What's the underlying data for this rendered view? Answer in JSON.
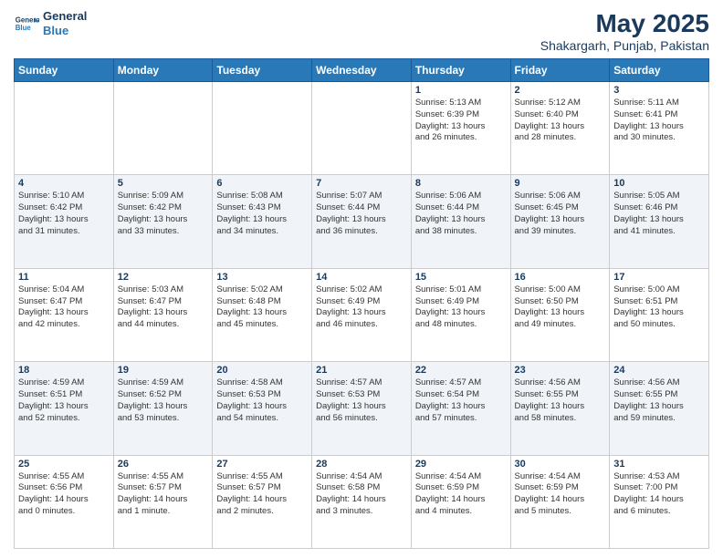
{
  "header": {
    "logo_line1": "General",
    "logo_line2": "Blue",
    "title": "May 2025",
    "subtitle": "Shakargarh, Punjab, Pakistan"
  },
  "weekdays": [
    "Sunday",
    "Monday",
    "Tuesday",
    "Wednesday",
    "Thursday",
    "Friday",
    "Saturday"
  ],
  "weeks": [
    [
      {
        "day": "",
        "info": ""
      },
      {
        "day": "",
        "info": ""
      },
      {
        "day": "",
        "info": ""
      },
      {
        "day": "",
        "info": ""
      },
      {
        "day": "1",
        "info": "Sunrise: 5:13 AM\nSunset: 6:39 PM\nDaylight: 13 hours\nand 26 minutes."
      },
      {
        "day": "2",
        "info": "Sunrise: 5:12 AM\nSunset: 6:40 PM\nDaylight: 13 hours\nand 28 minutes."
      },
      {
        "day": "3",
        "info": "Sunrise: 5:11 AM\nSunset: 6:41 PM\nDaylight: 13 hours\nand 30 minutes."
      }
    ],
    [
      {
        "day": "4",
        "info": "Sunrise: 5:10 AM\nSunset: 6:42 PM\nDaylight: 13 hours\nand 31 minutes."
      },
      {
        "day": "5",
        "info": "Sunrise: 5:09 AM\nSunset: 6:42 PM\nDaylight: 13 hours\nand 33 minutes."
      },
      {
        "day": "6",
        "info": "Sunrise: 5:08 AM\nSunset: 6:43 PM\nDaylight: 13 hours\nand 34 minutes."
      },
      {
        "day": "7",
        "info": "Sunrise: 5:07 AM\nSunset: 6:44 PM\nDaylight: 13 hours\nand 36 minutes."
      },
      {
        "day": "8",
        "info": "Sunrise: 5:06 AM\nSunset: 6:44 PM\nDaylight: 13 hours\nand 38 minutes."
      },
      {
        "day": "9",
        "info": "Sunrise: 5:06 AM\nSunset: 6:45 PM\nDaylight: 13 hours\nand 39 minutes."
      },
      {
        "day": "10",
        "info": "Sunrise: 5:05 AM\nSunset: 6:46 PM\nDaylight: 13 hours\nand 41 minutes."
      }
    ],
    [
      {
        "day": "11",
        "info": "Sunrise: 5:04 AM\nSunset: 6:47 PM\nDaylight: 13 hours\nand 42 minutes."
      },
      {
        "day": "12",
        "info": "Sunrise: 5:03 AM\nSunset: 6:47 PM\nDaylight: 13 hours\nand 44 minutes."
      },
      {
        "day": "13",
        "info": "Sunrise: 5:02 AM\nSunset: 6:48 PM\nDaylight: 13 hours\nand 45 minutes."
      },
      {
        "day": "14",
        "info": "Sunrise: 5:02 AM\nSunset: 6:49 PM\nDaylight: 13 hours\nand 46 minutes."
      },
      {
        "day": "15",
        "info": "Sunrise: 5:01 AM\nSunset: 6:49 PM\nDaylight: 13 hours\nand 48 minutes."
      },
      {
        "day": "16",
        "info": "Sunrise: 5:00 AM\nSunset: 6:50 PM\nDaylight: 13 hours\nand 49 minutes."
      },
      {
        "day": "17",
        "info": "Sunrise: 5:00 AM\nSunset: 6:51 PM\nDaylight: 13 hours\nand 50 minutes."
      }
    ],
    [
      {
        "day": "18",
        "info": "Sunrise: 4:59 AM\nSunset: 6:51 PM\nDaylight: 13 hours\nand 52 minutes."
      },
      {
        "day": "19",
        "info": "Sunrise: 4:59 AM\nSunset: 6:52 PM\nDaylight: 13 hours\nand 53 minutes."
      },
      {
        "day": "20",
        "info": "Sunrise: 4:58 AM\nSunset: 6:53 PM\nDaylight: 13 hours\nand 54 minutes."
      },
      {
        "day": "21",
        "info": "Sunrise: 4:57 AM\nSunset: 6:53 PM\nDaylight: 13 hours\nand 56 minutes."
      },
      {
        "day": "22",
        "info": "Sunrise: 4:57 AM\nSunset: 6:54 PM\nDaylight: 13 hours\nand 57 minutes."
      },
      {
        "day": "23",
        "info": "Sunrise: 4:56 AM\nSunset: 6:55 PM\nDaylight: 13 hours\nand 58 minutes."
      },
      {
        "day": "24",
        "info": "Sunrise: 4:56 AM\nSunset: 6:55 PM\nDaylight: 13 hours\nand 59 minutes."
      }
    ],
    [
      {
        "day": "25",
        "info": "Sunrise: 4:55 AM\nSunset: 6:56 PM\nDaylight: 14 hours\nand 0 minutes."
      },
      {
        "day": "26",
        "info": "Sunrise: 4:55 AM\nSunset: 6:57 PM\nDaylight: 14 hours\nand 1 minute."
      },
      {
        "day": "27",
        "info": "Sunrise: 4:55 AM\nSunset: 6:57 PM\nDaylight: 14 hours\nand 2 minutes."
      },
      {
        "day": "28",
        "info": "Sunrise: 4:54 AM\nSunset: 6:58 PM\nDaylight: 14 hours\nand 3 minutes."
      },
      {
        "day": "29",
        "info": "Sunrise: 4:54 AM\nSunset: 6:59 PM\nDaylight: 14 hours\nand 4 minutes."
      },
      {
        "day": "30",
        "info": "Sunrise: 4:54 AM\nSunset: 6:59 PM\nDaylight: 14 hours\nand 5 minutes."
      },
      {
        "day": "31",
        "info": "Sunrise: 4:53 AM\nSunset: 7:00 PM\nDaylight: 14 hours\nand 6 minutes."
      }
    ]
  ]
}
